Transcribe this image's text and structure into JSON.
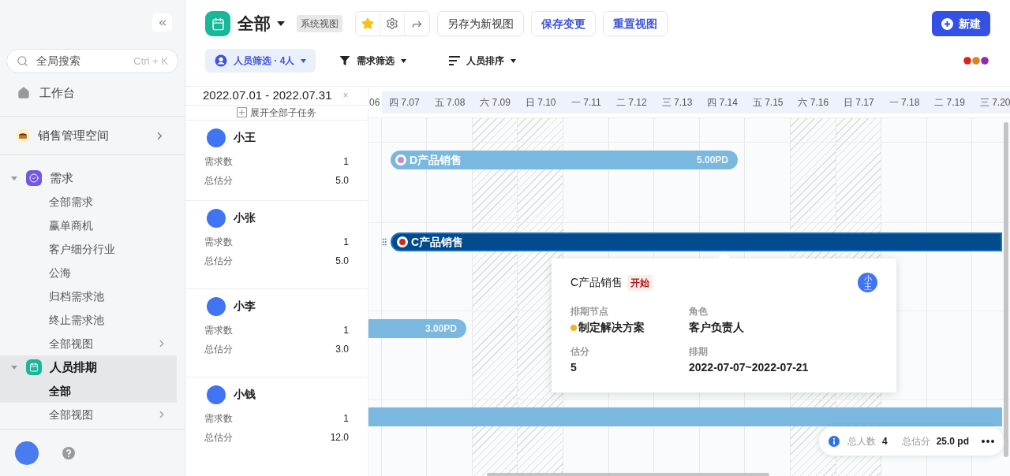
{
  "sidebar": {
    "search": {
      "placeholder": "全局搜索",
      "shortcut": "Ctrl + K"
    },
    "home": "工作台",
    "space": "销售管理空间",
    "tree": [
      {
        "label": "需求",
        "expanded": true,
        "selected": false,
        "children": [
          {
            "label": "全部需求",
            "kind": "view",
            "selected": false
          },
          {
            "label": "赢单商机",
            "kind": "view",
            "selected": false
          },
          {
            "label": "客户细分行业",
            "kind": "view",
            "selected": false
          },
          {
            "label": "公海",
            "kind": "view",
            "selected": false
          },
          {
            "label": "归档需求池",
            "kind": "view",
            "selected": false
          },
          {
            "label": "终止需求池",
            "kind": "view",
            "selected": false
          },
          {
            "label": "全部视图",
            "kind": "submenu",
            "selected": false
          }
        ]
      },
      {
        "label": "人员排期",
        "expanded": true,
        "selected": true,
        "children": [
          {
            "label": "全部",
            "kind": "view",
            "selected": true
          },
          {
            "label": "全部视图",
            "kind": "submenu",
            "selected": false
          }
        ]
      }
    ]
  },
  "header": {
    "title": "全部",
    "view_tag": "系统视图",
    "starred": true,
    "buttons": [
      {
        "label": "另存为新视图",
        "kind": "default"
      },
      {
        "label": "保存变更",
        "kind": "link"
      },
      {
        "label": "重置视图",
        "kind": "link"
      }
    ],
    "new_button": "新建",
    "filters": [
      {
        "label": "人员筛选 · 4人",
        "active": true
      },
      {
        "label": "需求筛选",
        "active": false
      },
      {
        "label": "人员排序",
        "active": false
      }
    ]
  },
  "timeline": {
    "range": "2022.07.01 - 2022.07.31",
    "clear": "×",
    "expand_all": "展开全部子任务",
    "days": [
      {
        "label": "06",
        "weekend": false,
        "highlighted": false
      },
      {
        "label": "四 7.07",
        "weekend": false,
        "highlighted": true
      },
      {
        "label": "五 7.08",
        "weekend": false,
        "highlighted": true
      },
      {
        "label": "六 7.09",
        "weekend": true,
        "highlighted": true
      },
      {
        "label": "日 7.10",
        "weekend": true,
        "highlighted": true
      },
      {
        "label": "一 7.11",
        "weekend": false,
        "highlighted": true
      },
      {
        "label": "二 7.12",
        "weekend": false,
        "highlighted": true
      },
      {
        "label": "三 7.13",
        "weekend": false,
        "highlighted": true
      },
      {
        "label": "四 7.14",
        "weekend": false,
        "highlighted": true
      },
      {
        "label": "五 7.15",
        "weekend": false,
        "highlighted": true
      },
      {
        "label": "六 7.16",
        "weekend": true,
        "highlighted": true
      },
      {
        "label": "日 7.17",
        "weekend": true,
        "highlighted": true
      },
      {
        "label": "一 7.18",
        "weekend": false,
        "highlighted": true
      },
      {
        "label": "二 7.19",
        "weekend": false,
        "highlighted": true
      },
      {
        "label": "三 7.20",
        "weekend": false,
        "highlighted": true
      }
    ],
    "people": [
      {
        "name": "小王",
        "count_label": "需求数",
        "count": "1",
        "score_label": "总估分",
        "score": "5.0",
        "bar": {
          "kind": "light",
          "title": "D产品销售",
          "color": "#c58ad6",
          "estimate": "5.00PD"
        }
      },
      {
        "name": "小张",
        "count_label": "需求数",
        "count": "1",
        "score_label": "总估分",
        "score": "5.0",
        "bar": {
          "kind": "dark",
          "title": "C产品销售",
          "color": "#d9261c"
        }
      },
      {
        "name": "小李",
        "count_label": "需求数",
        "count": "1",
        "score_label": "总估分",
        "score": "3.0",
        "bar": {
          "kind": "light",
          "estimate": "3.00PD"
        }
      },
      {
        "name": "小钱",
        "count_label": "需求数",
        "count": "1",
        "score_label": "总估分",
        "score": "12.0",
        "bar": {
          "kind": "light"
        }
      }
    ],
    "tooltip": {
      "title": "C产品销售",
      "status": "开始",
      "avatar": "小王",
      "fields": [
        {
          "label": "排期节点",
          "value": "制定解决方案",
          "color": "#f0b323"
        },
        {
          "label": "角色",
          "value": "客户负责人"
        },
        {
          "label": "估分",
          "value": "5"
        },
        {
          "label": "排期",
          "value": "2022-07-07~2022-07-21"
        }
      ]
    },
    "summary": [
      {
        "label": "总人数",
        "value": "4"
      },
      {
        "label": "总估分",
        "value": "25.0 pd"
      }
    ]
  }
}
